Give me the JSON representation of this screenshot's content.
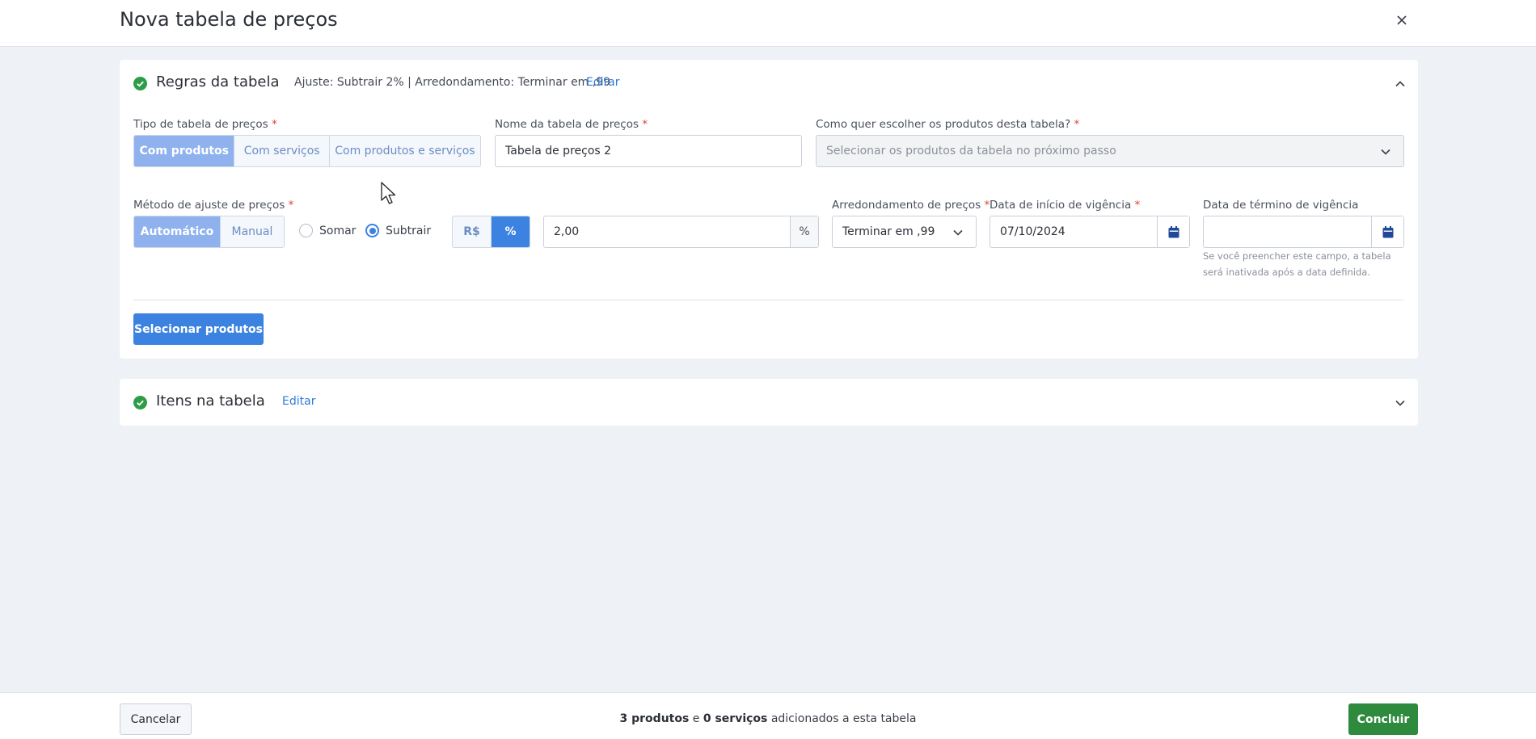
{
  "header": {
    "title": "Nova tabela de preços"
  },
  "rules_section": {
    "title": "Regras da tabela",
    "summary": "Ajuste: Subtrair 2% | Arredondamento: Terminar em ,99",
    "edit_label": "Editar",
    "table_type": {
      "label": "Tipo de tabela de preços",
      "required": "*",
      "options": [
        "Com produtos",
        "Com serviços",
        "Com produtos e serviços"
      ],
      "selected": "Com produtos"
    },
    "table_name": {
      "label": "Nome da tabela de preços",
      "required": "*",
      "value": "Tabela de preços 2"
    },
    "product_choice": {
      "label": "Como quer escolher os produtos desta tabela?",
      "required": "*",
      "value": "Selecionar os produtos da tabela no próximo passo"
    },
    "adjust_method": {
      "label": "Método de ajuste de preços",
      "required": "*",
      "options": [
        "Automático",
        "Manual"
      ],
      "selected": "Automático"
    },
    "operation": {
      "options": [
        "Somar",
        "Subtrair"
      ],
      "selected": "Subtrair"
    },
    "unit": {
      "options": [
        "R$",
        "%"
      ],
      "selected": "%"
    },
    "adjust_value": {
      "value": "2,00",
      "suffix": "%"
    },
    "rounding": {
      "label": "Arredondamento de preços",
      "required": "*",
      "value": "Terminar em ,99"
    },
    "start_date": {
      "label": "Data de início de vigência",
      "required": "*",
      "value": "07/10/2024"
    },
    "end_date": {
      "label": "Data de término de vigência",
      "value": "",
      "helper": "Se você preencher este campo, a tabela será inativada após a data definida."
    },
    "select_products_label": "Selecionar produtos"
  },
  "items_section": {
    "title": "Itens na tabela",
    "edit_label": "Editar"
  },
  "footer": {
    "cancel_label": "Cancelar",
    "products_count": "3 produtos",
    "connector": "e",
    "services_count": "0 serviços",
    "summary_suffix": "adicionados a esta tabela",
    "done_label": "Concluir"
  },
  "colors": {
    "primary": "#3c82e0",
    "primary_light": "#8fb2ee",
    "success": "#2e8b3e",
    "required": "#d9452e",
    "link": "#2f7ad8"
  }
}
